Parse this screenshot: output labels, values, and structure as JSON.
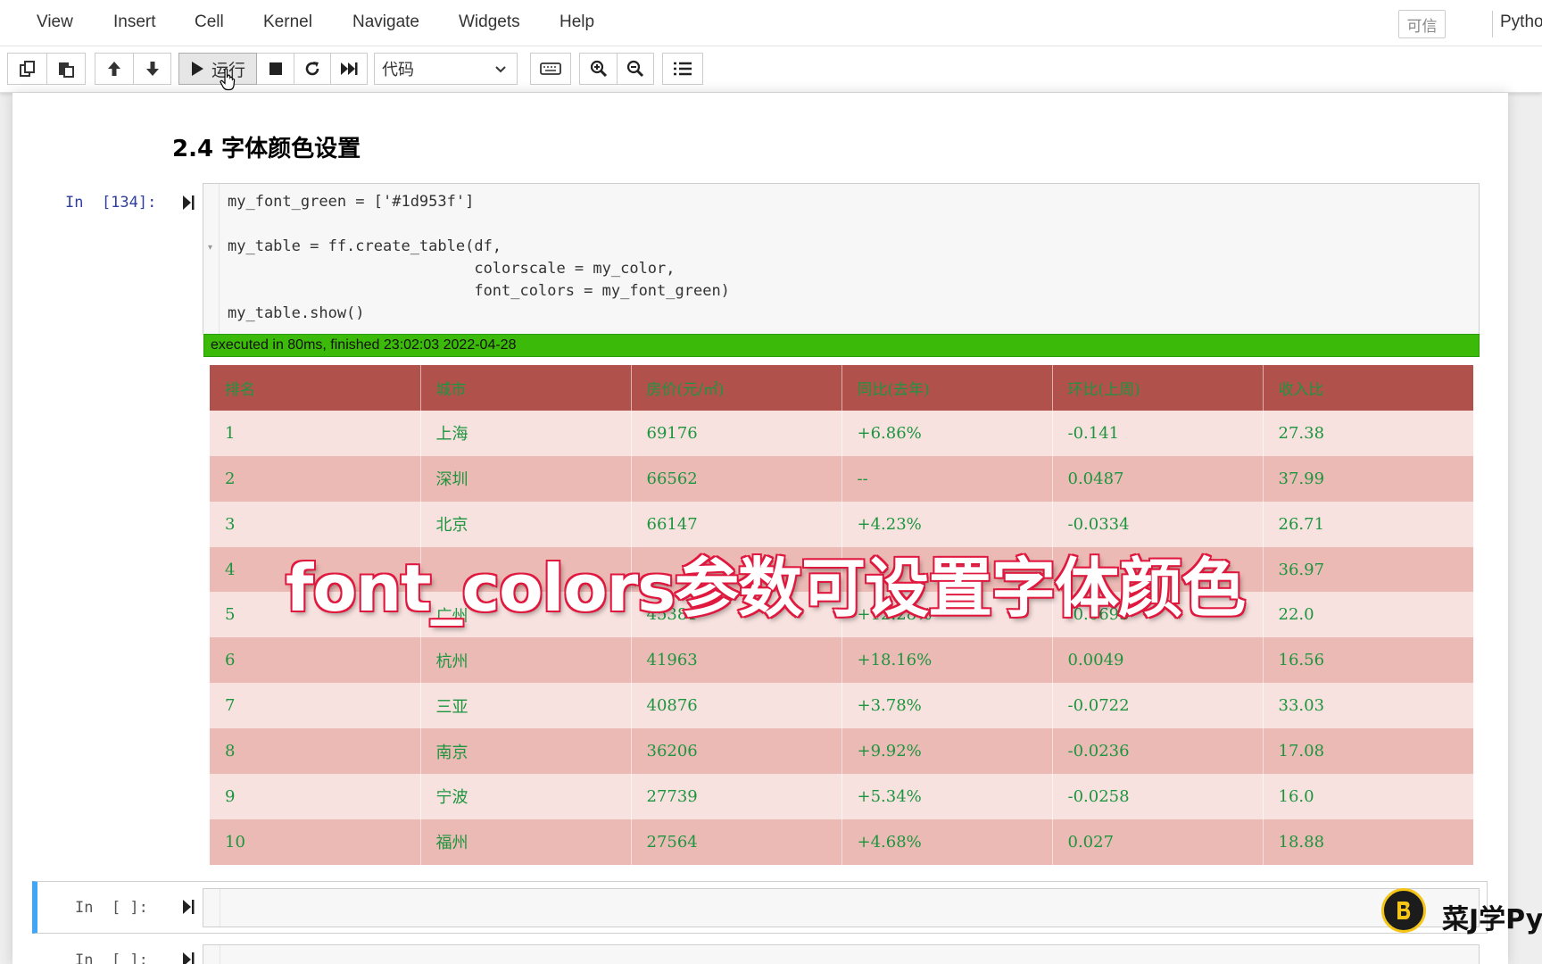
{
  "menubar": {
    "items": [
      "View",
      "Insert",
      "Cell",
      "Kernel",
      "Navigate",
      "Widgets",
      "Help"
    ],
    "trusted_label": "可信",
    "kernel_name": "Pytho"
  },
  "toolbar": {
    "run_label": "运行",
    "cell_type_value": "代码",
    "buttons": [
      "copy-icon",
      "paste-icon",
      "arrow-up-icon",
      "arrow-down-icon",
      "run-icon",
      "stop-icon",
      "restart-icon",
      "fast-forward-icon",
      "keyboard-icon",
      "zoom-in-icon",
      "zoom-out-icon",
      "list-icon"
    ]
  },
  "notebook": {
    "heading": "2.4  字体颜色设置",
    "cell1": {
      "prompt": "In  [134]:",
      "code": [
        "my_font_green = ['#1d953f']",
        "",
        "my_table = ff.create_table(df,",
        "                           colorscale = my_color,",
        "                           font_colors = my_font_green)",
        "my_table.show()"
      ],
      "exec_status": "executed in 80ms, finished 23:02:03 2022-04-28"
    },
    "empty_prompt": "In  [ ]:",
    "empty_prompt2": "In  [ ]:"
  },
  "table": {
    "header_color": "#b0524b",
    "odd_row_color": "#f7e2df",
    "even_row_color": "#ecbab5",
    "font_color": "#1d953f",
    "headers": [
      "排名",
      "城市",
      "房价(元/㎡)",
      "同比(去年)",
      "环比(上周)",
      "收入比"
    ],
    "rows": [
      [
        "1",
        "上海",
        "69176",
        "+6.86%",
        "-0.141",
        "27.38"
      ],
      [
        "2",
        "深圳",
        "66562",
        "--",
        "0.0487",
        "37.99"
      ],
      [
        "3",
        "北京",
        "66147",
        "+4.23%",
        "-0.0334",
        "26.71"
      ],
      [
        "4",
        "",
        "",
        "",
        "",
        "36.97"
      ],
      [
        "5",
        "广州",
        "45381",
        "+12.28%",
        "-0.0693",
        "22.0"
      ],
      [
        "6",
        "杭州",
        "41963",
        "+18.16%",
        "0.0049",
        "16.56"
      ],
      [
        "7",
        "三亚",
        "40876",
        "+3.78%",
        "-0.0722",
        "33.03"
      ],
      [
        "8",
        "南京",
        "36206",
        "+9.92%",
        "-0.0236",
        "17.08"
      ],
      [
        "9",
        "宁波",
        "27739",
        "+5.34%",
        "-0.0258",
        "16.0"
      ],
      [
        "10",
        "福州",
        "27564",
        "+4.68%",
        "0.027",
        "18.88"
      ]
    ]
  },
  "overlay": {
    "subtitle": "font_colors参数可设置字体颜色",
    "watermark": "菜J学Pyt"
  }
}
